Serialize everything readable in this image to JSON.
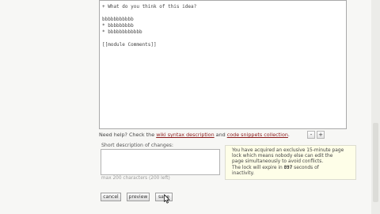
{
  "editor": {
    "content": "+ What do you think of this idea?\n\nbbbbbbbbbbb\n* bbbbbbbbb\n* bbbbbbbbbbbb\n\n[[module Comments]]"
  },
  "help": {
    "prefix": "Need help? Check the ",
    "syntax_link": "wiki syntax description",
    "middle": " and ",
    "snippets_link": "code snippets collection",
    "suffix": ".",
    "shrink_label": "-",
    "grow_label": "+"
  },
  "summary": {
    "label": "Short description of changes:",
    "value": "",
    "limit_note": "max 200 characters (200 left)"
  },
  "lock_notice": {
    "line1": "You have acquired an exclusive 15-minute page",
    "line2": "lock which means nobody else can edit the",
    "line3": "page simultaneously to avoid conflicts.",
    "line4_prefix": "The lock will expire in ",
    "seconds": "897",
    "line4_suffix": " seconds of",
    "line5": "inactivity."
  },
  "buttons": {
    "cancel": "cancel",
    "preview": "preview",
    "save": "save"
  },
  "icons": {
    "cursor": "mouse-pointer-icon"
  }
}
